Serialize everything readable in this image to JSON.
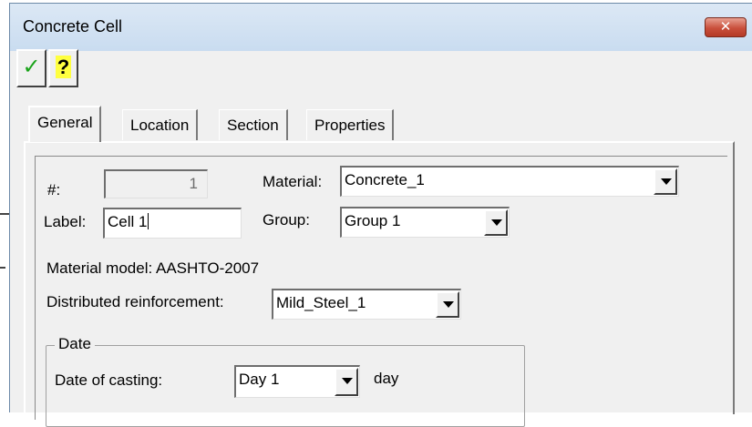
{
  "window": {
    "title": "Concrete Cell",
    "close_label": "✕"
  },
  "toolbar": {
    "ok_icon": "✓",
    "help_icon": "?"
  },
  "tabs": [
    {
      "label": "General",
      "active": true
    },
    {
      "label": "Location",
      "active": false
    },
    {
      "label": "Section",
      "active": false
    },
    {
      "label": "Properties",
      "active": false
    }
  ],
  "general": {
    "number_label": "#:",
    "number_value": "1",
    "label_label": "Label:",
    "label_value": "Cell 1",
    "material_label": "Material:",
    "material_value": "Concrete_1",
    "group_label": "Group:",
    "group_value": "Group 1",
    "material_model_text": "Material model: AASHTO-2007",
    "distributed_label": "Distributed reinforcement:",
    "distributed_value": "Mild_Steel_1"
  },
  "date": {
    "group_title": "Date",
    "casting_label": "Date of casting:",
    "casting_value": "Day 1",
    "unit": "day"
  },
  "colors": {
    "accept": "#1aa31a",
    "close": "#c94f3b",
    "face": "#f0f0f0"
  }
}
